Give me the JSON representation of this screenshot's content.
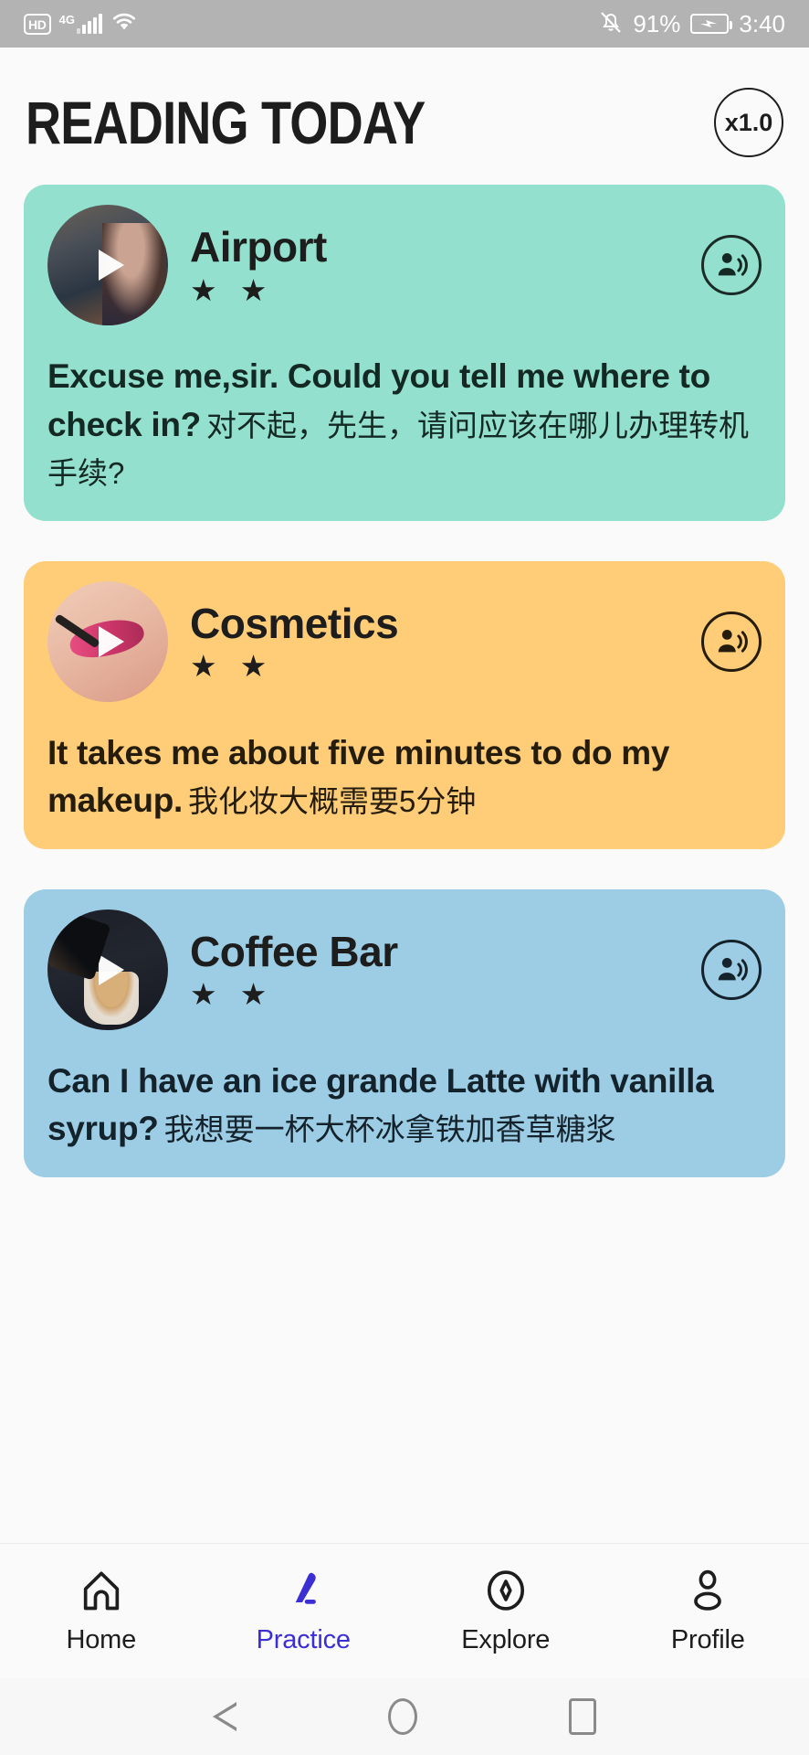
{
  "status_bar": {
    "hd_label": "HD",
    "network_label": "4G",
    "signal_icon": "signal-bars-icon",
    "wifi_icon": "wifi-icon",
    "silent_icon": "bell-slash-icon",
    "battery_percent": "91%",
    "battery_icon": "battery-charging-icon",
    "clock": "3:40"
  },
  "header": {
    "title": "READING TODAY",
    "speed_badge": "x1.0"
  },
  "cards": [
    {
      "title": "Airport",
      "stars": "★ ★",
      "star_count": 2,
      "english": "Excuse me,sir. Could you tell me where to check in?",
      "chinese": "对不起，先生，请问应该在哪儿办理转机手续?",
      "color": "#93e0ce",
      "thumbnail": "airport-thumbnail",
      "play_icon": "play-icon",
      "speak_icon": "record-voice-over-icon"
    },
    {
      "title": "Cosmetics",
      "stars": "★ ★",
      "star_count": 2,
      "english": "It takes me about five minutes to do my makeup.",
      "chinese": "我化妆大概需要5分钟",
      "color": "#ffcc77",
      "thumbnail": "cosmetics-thumbnail",
      "play_icon": "play-icon",
      "speak_icon": "record-voice-over-icon"
    },
    {
      "title": "Coffee Bar",
      "stars": "★ ★",
      "star_count": 2,
      "english": "Can I have an ice grande Latte with vanilla syrup?",
      "chinese": "我想要一杯大杯冰拿铁加香草糖浆",
      "color": "#9ccde5",
      "thumbnail": "coffee-thumbnail",
      "play_icon": "play-icon",
      "speak_icon": "record-voice-over-icon"
    }
  ],
  "bottom_nav": {
    "active_color": "#3b2fd4",
    "items": [
      {
        "label": "Home",
        "icon": "home-icon",
        "active": false
      },
      {
        "label": "Practice",
        "icon": "pencil-icon",
        "active": true
      },
      {
        "label": "Explore",
        "icon": "compass-icon",
        "active": false
      },
      {
        "label": "Profile",
        "icon": "person-icon",
        "active": false
      }
    ]
  },
  "system_nav": {
    "back": "back-triangle-icon",
    "home": "home-circle-icon",
    "recent": "recent-square-icon"
  }
}
